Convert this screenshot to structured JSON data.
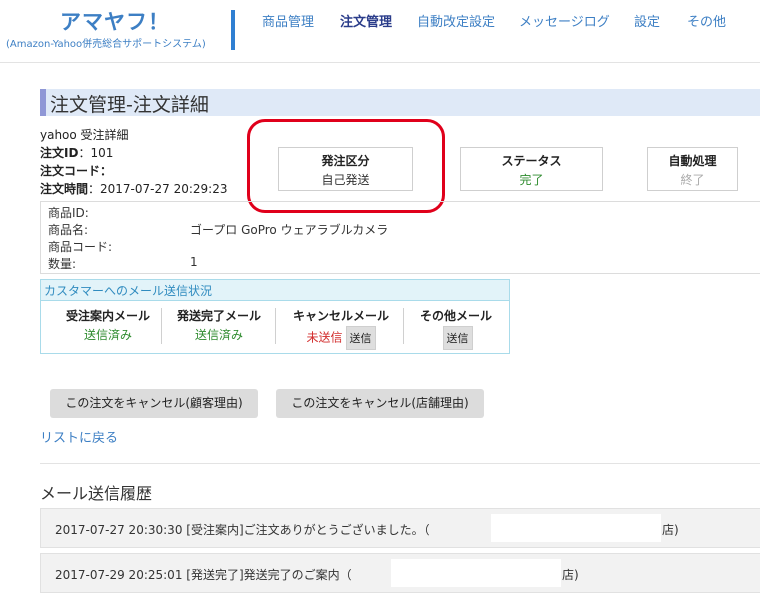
{
  "header": {
    "logo_title": "アマヤフ！",
    "logo_subtitle": "(Amazon-Yahoo併売総合サポートシステム)",
    "nav": [
      {
        "label": "商品管理"
      },
      {
        "label": "注文管理"
      },
      {
        "label": "自動改定設定"
      },
      {
        "label": "メッセージログ"
      },
      {
        "label": "設定"
      },
      {
        "label": "その他"
      }
    ]
  },
  "page_title": "注文管理-注文詳細",
  "order": {
    "source": "yahoo 受注詳細",
    "id_label": "注文ID",
    "id_value": "：101",
    "code_label": "注文コード",
    "code_value": "：",
    "time_label": "注文時間",
    "time_value": "：2017-07-27 20:29:23"
  },
  "status_boxes": [
    {
      "label": "発注区分",
      "value": "自己発送",
      "color": "#333333"
    },
    {
      "label": "ステータス",
      "value": "完了",
      "color": "#2e8b2e"
    },
    {
      "label": "自動処理",
      "value": "終了",
      "color": "#aaaaaa"
    }
  ],
  "product": {
    "rows": [
      {
        "label": "商品ID:",
        "value": ""
      },
      {
        "label": "商品名:",
        "value": "ゴープロ GoPro ウェアラブルカメラ"
      },
      {
        "label": "商品コード:",
        "value": ""
      },
      {
        "label": "数量:",
        "value": "1"
      }
    ]
  },
  "mail_status": {
    "title": "カスタマーへのメール送信状況",
    "send_label": "送信",
    "columns": [
      {
        "title": "受注案内メール",
        "status": "送信済み",
        "color": "#2e8b2e"
      },
      {
        "title": "発送完了メール",
        "status": "送信済み",
        "color": "#2e8b2e"
      },
      {
        "title": "キャンセルメール",
        "status": "未送信",
        "color": "#d22b2b"
      },
      {
        "title": "その他メール",
        "status": "",
        "color": "#333333"
      }
    ]
  },
  "actions": {
    "cancel_customer": "この注文をキャンセル(顧客理由)",
    "cancel_store": "この注文をキャンセル(店舗理由)",
    "back": "リストに戻る"
  },
  "history": {
    "title": "メール送信履歴",
    "items": [
      {
        "text": "2017-07-27 20:30:30 [受注案内]ご注文ありがとうございました。（",
        "suffix": "店)"
      },
      {
        "text": "2017-07-29 20:25:01 [発送完了]発送完了のご案内（",
        "suffix": "店)"
      }
    ]
  }
}
